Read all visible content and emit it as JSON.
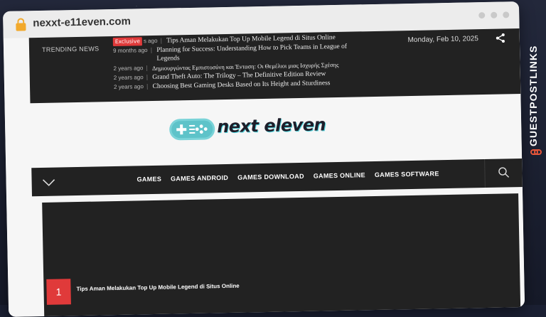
{
  "browser": {
    "url": "nexxt-e11even.com"
  },
  "trending": {
    "label": "TRENDING NEWS",
    "badge": "Exclusive",
    "items": [
      {
        "time": "s ago",
        "title": "Tips Aman Melakukan Top Up Mobile Legend di Situs Online"
      },
      {
        "time": "9 months ago",
        "title": "Planning for Success: Understanding How to Pick Teams in League of Legends"
      },
      {
        "time": "2 years ago",
        "title": "Δημιουργώντας Εμπιστοσύνη και Ένταση: Οι Θεμέλιοι μιας Ισχυρής Σχέσης"
      },
      {
        "time": "2 years ago",
        "title": "Grand Theft Auto: The Trilogy – The Definitive Edition Review"
      },
      {
        "time": "2 years ago",
        "title": "Choosing Best Gaming Desks Based on Its Height and Sturdiness"
      }
    ],
    "date": "Monday, Feb 10, 2025"
  },
  "logo": {
    "text": "next eleven",
    "icon": "gamepad-icon",
    "accent": "#52d7e0"
  },
  "nav": {
    "items": [
      "GAMES",
      "GAMES ANDROID",
      "GAMES DOWNLOAD",
      "GAMES ONLINE",
      "GAMES SOFTWARE"
    ]
  },
  "hero": {
    "number": "1",
    "title": "Tips Aman Melakukan Top Up Mobile Legend di Situs Online"
  },
  "watermark": {
    "text": "GUESTPOSTLINKS",
    "icon": "link-icon",
    "accent": "#e8563a"
  },
  "colors": {
    "badge": "#e03a3a",
    "dark": "#222222"
  }
}
